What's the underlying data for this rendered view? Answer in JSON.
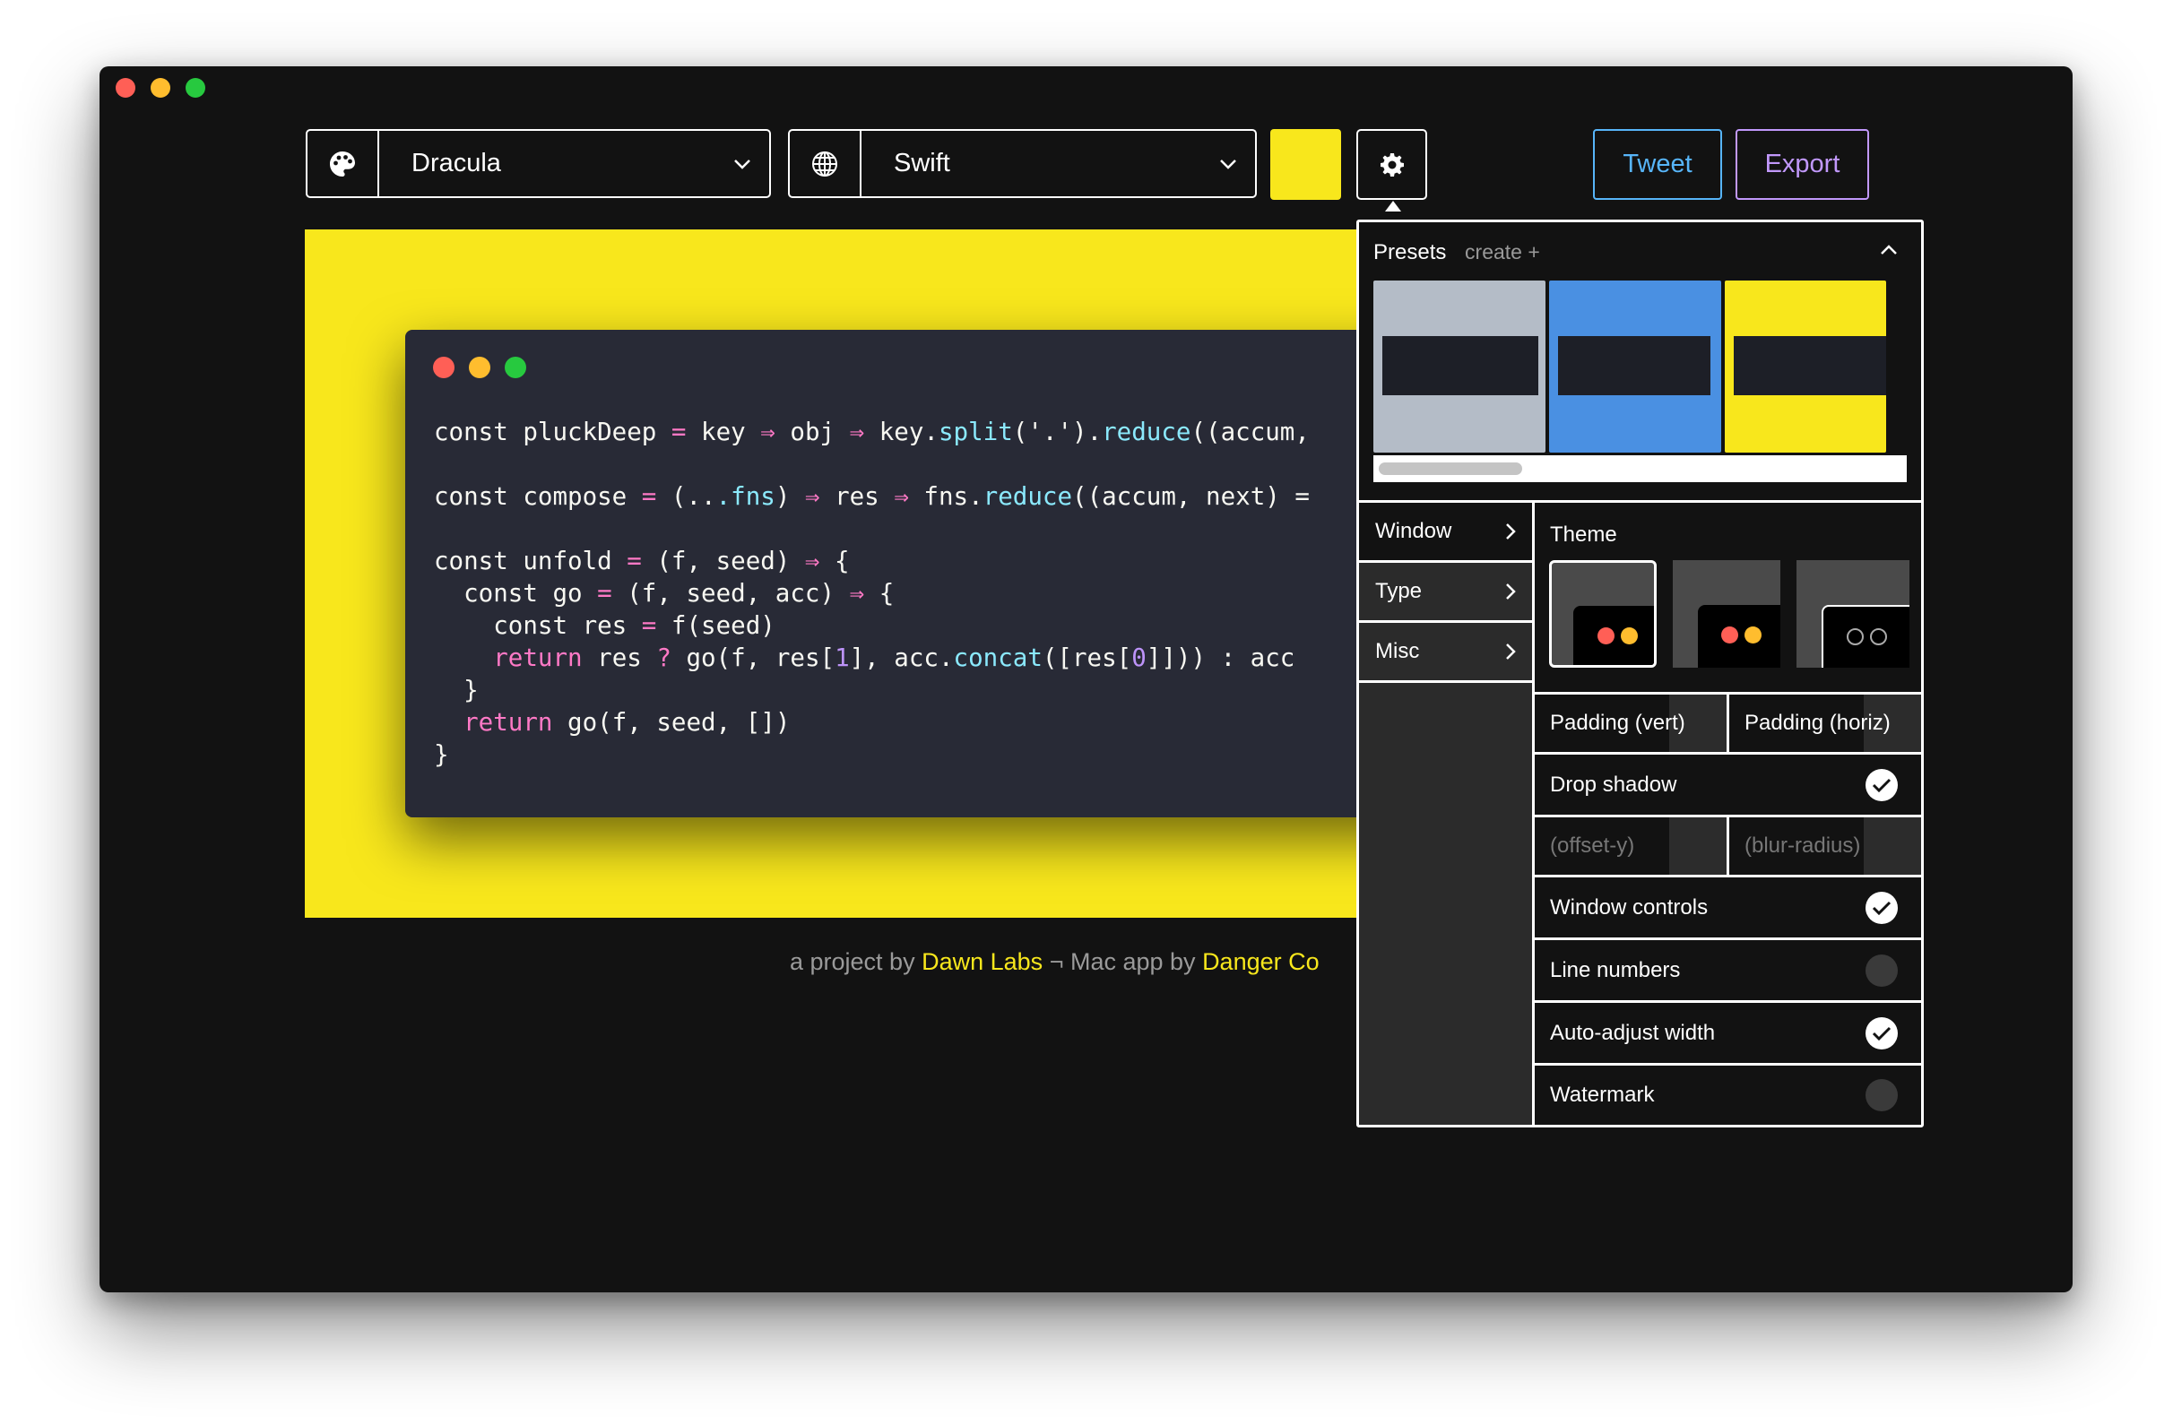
{
  "toolbar": {
    "theme_dropdown": {
      "value": "Dracula",
      "icon": "palette-icon"
    },
    "language_dropdown": {
      "value": "Swift",
      "icon": "globe-icon"
    },
    "background_color": "#f8e71c",
    "settings_icon": "gear-icon",
    "tweet_label": "Tweet",
    "export_label": "Export"
  },
  "code": {
    "lines": [
      "const pluckDeep = key => obj => key.split('.').reduce((accum,",
      "",
      "const compose = (...fns) => res => fns.reduce((accum, next) =",
      "",
      "const unfold = (f, seed) => {",
      "  const go = (f, seed, acc) => {",
      "    const res = f(seed)",
      "    return res ? go(f, res[1], acc.concat([res[0]])) : acc",
      "  }",
      "  return go(f, seed, [])",
      "}"
    ]
  },
  "footer": {
    "prefix": "a project by",
    "link1": "Dawn Labs",
    "separator": "¬ Mac app by",
    "link2": "Danger Co"
  },
  "settings": {
    "presets": {
      "title": "Presets",
      "create": "create +",
      "preset_colors": [
        "#b4bcc7",
        "#4a90e2",
        "#f8e71c"
      ]
    },
    "menu": [
      "Window",
      "Type",
      "Misc"
    ],
    "theme": {
      "title": "Theme"
    },
    "padding_vert": "Padding (vert)",
    "padding_horiz": "Padding (horiz)",
    "drop_shadow": {
      "label": "Drop shadow",
      "checked": true
    },
    "offset_y": "(offset-y)",
    "blur_radius": "(blur-radius)",
    "window_controls": {
      "label": "Window controls",
      "checked": true
    },
    "line_numbers": {
      "label": "Line numbers",
      "checked": false
    },
    "auto_adjust_width": {
      "label": "Auto-adjust width",
      "checked": true
    },
    "watermark": {
      "label": "Watermark",
      "checked": false
    }
  }
}
